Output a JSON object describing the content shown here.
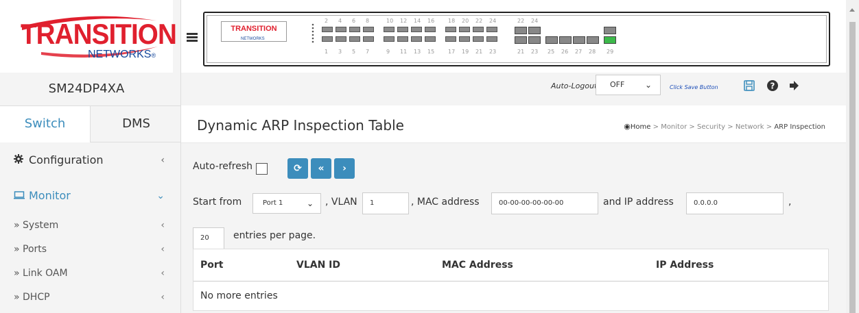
{
  "brand": {
    "logo_title": "TRANSITION",
    "logo_sub": "NETWORKS",
    "logo_reg": "®",
    "panel_logo_title": "TRANSITION",
    "panel_logo_sub": "NETWORKS",
    "accent": "#3c8dbc",
    "red": "#e0202e",
    "blue": "#14469a"
  },
  "device_name": "SM24DP4XA",
  "tabs": [
    {
      "label": "Switch",
      "active": true
    },
    {
      "label": "DMS",
      "active": false
    }
  ],
  "nav": {
    "configuration": {
      "label": "Configuration",
      "icon": "gear-icon",
      "chevron": "‹"
    },
    "monitor": {
      "label": "Monitor",
      "icon": "monitor-icon",
      "chevron": "⌄"
    },
    "sub_items": [
      {
        "label": "» System",
        "chevron": "‹"
      },
      {
        "label": "» Ports",
        "chevron": "‹"
      },
      {
        "label": "» Link OAM",
        "chevron": "‹"
      },
      {
        "label": "» DHCP",
        "chevron": "‹"
      }
    ]
  },
  "port_panel": {
    "top_numbers": [
      "2",
      "4",
      "6",
      "8",
      "10",
      "12",
      "14",
      "16",
      "18",
      "20",
      "22",
      "24",
      "22",
      "24"
    ],
    "bottom_numbers": [
      "1",
      "3",
      "5",
      "7",
      "9",
      "11",
      "13",
      "15",
      "17",
      "19",
      "21",
      "23",
      "21",
      "23",
      "25",
      "26",
      "27",
      "28",
      "29"
    ]
  },
  "toolbar": {
    "auto_logout_label": "Auto-Logout",
    "auto_logout_value": "OFF",
    "save_link": "Click Save Button"
  },
  "page": {
    "title": "Dynamic ARP Inspection Table",
    "breadcrumb": [
      "Home",
      "Monitor",
      "Security",
      "Network",
      "ARP Inspection"
    ],
    "breadcrumb_sep": ">"
  },
  "form": {
    "auto_refresh_label": "Auto-refresh",
    "start_from_label": "Start from",
    "port_value": "Port 1",
    "vlan_label": ", VLAN",
    "vlan_value": "1",
    "mac_label": ", MAC address",
    "mac_value": "00-00-00-00-00-00",
    "ip_label": "and IP address",
    "ip_value": "0.0.0.0",
    "trailing_comma": ",",
    "entries_value": "20",
    "entries_label": "entries per page.",
    "btn_refresh": "⟳",
    "btn_first": "«",
    "btn_next": "›"
  },
  "table": {
    "columns": [
      "Port",
      "VLAN ID",
      "MAC Address",
      "IP Address"
    ],
    "empty_message": "No more entries"
  }
}
